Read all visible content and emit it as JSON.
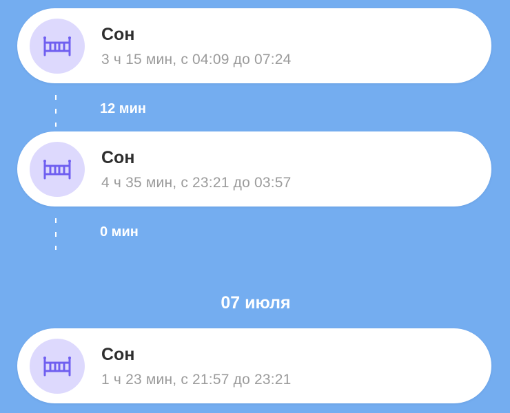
{
  "colors": {
    "background": "#74adf0",
    "card": "#ffffff",
    "icon_bg": "#ddd9fd",
    "icon": "#6f5ff0",
    "title": "#2e2e2e",
    "subtitle": "#9b9b9b"
  },
  "entries": [
    {
      "icon": "crib-icon",
      "title": "Сон",
      "subtitle": "3 ч 15 мин, с 04:09 до 07:24"
    },
    {
      "icon": "crib-icon",
      "title": "Сон",
      "subtitle": "4 ч 35 мин, с 23:21 до 03:57"
    },
    {
      "icon": "crib-icon",
      "title": "Сон",
      "subtitle": "1 ч 23 мин, с 21:57 до 23:21"
    }
  ],
  "gaps": [
    {
      "label": "12 мин"
    },
    {
      "label": "0 мин"
    }
  ],
  "date_header": "07 июля"
}
